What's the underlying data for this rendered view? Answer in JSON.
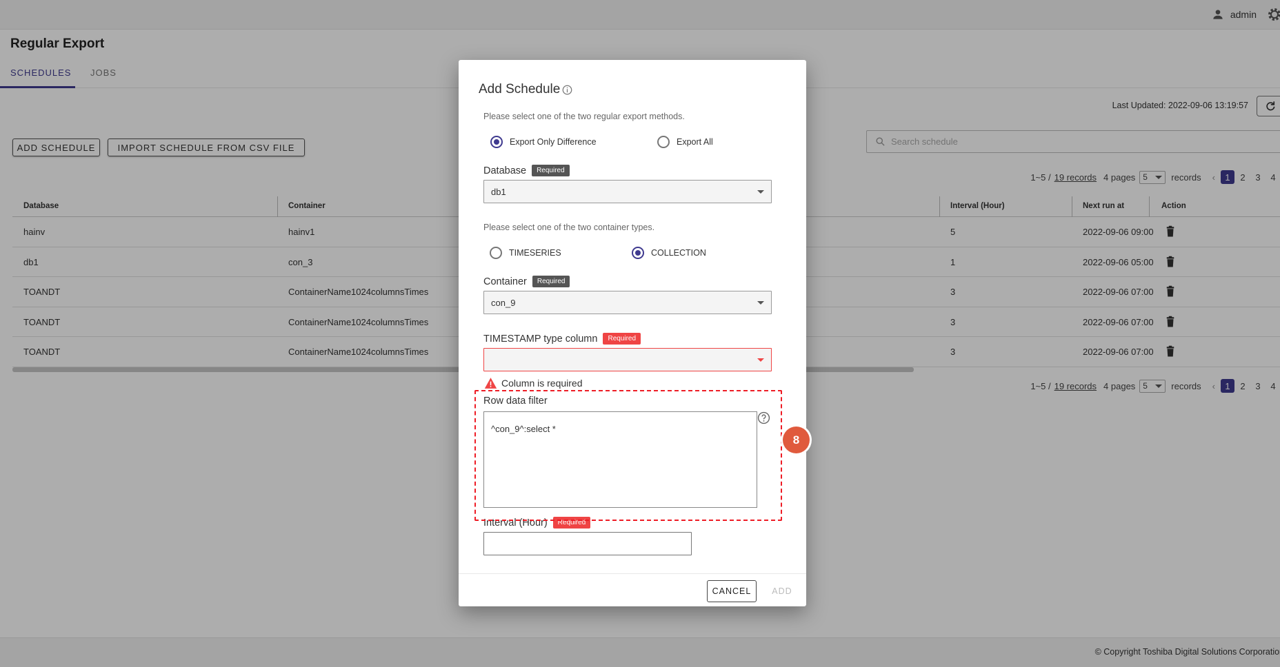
{
  "header": {
    "username": "admin"
  },
  "page": {
    "title": "Regular Export",
    "tabs": [
      {
        "label": "SCHEDULES",
        "active": true
      },
      {
        "label": "JOBS",
        "active": false
      }
    ],
    "last_updated": "Last Updated: 2022-09-06 13:19:57",
    "add_schedule_label": "ADD SCHEDULE",
    "import_label": "IMPORT SCHEDULE FROM CSV FILE",
    "search_placeholder": "Search schedule"
  },
  "pagination": {
    "range": "1~5 /",
    "records_link": "19 records",
    "pages": "4 pages",
    "page_size": "5",
    "records_suffix": "records",
    "page_numbers": [
      "1",
      "2",
      "3",
      "4"
    ],
    "current_page": "1"
  },
  "table": {
    "columns": [
      "Database",
      "Container",
      "Interval (Hour)",
      "Next run at",
      "Action"
    ],
    "rows": [
      {
        "database": "hainv",
        "container": "hainv1",
        "interval": "5",
        "next_run": "2022-09-06 09:00"
      },
      {
        "database": "db1",
        "container": "con_3",
        "interval": "1",
        "next_run": "2022-09-06 05:00"
      },
      {
        "database": "TOANDT",
        "container": "ContainerName1024columnsTimes",
        "interval": "3",
        "next_run": "2022-09-06 07:00"
      },
      {
        "database": "TOANDT",
        "container": "ContainerName1024columnsTimes",
        "interval": "3",
        "next_run": "2022-09-06 07:00"
      },
      {
        "database": "TOANDT",
        "container": "ContainerName1024columnsTimes",
        "interval": "3",
        "next_run": "2022-09-06 07:00"
      }
    ]
  },
  "footer": {
    "copyright": "© Copyright Toshiba Digital Solutions Corporation"
  },
  "modal": {
    "title": "Add Schedule",
    "export_hint": "Please select one of the two regular export methods.",
    "export_options": [
      {
        "label": "Export Only Difference",
        "checked": true
      },
      {
        "label": "Export All",
        "checked": false
      }
    ],
    "database_label": "Database",
    "required_badge": "Required",
    "database_value": "db1",
    "container_hint": "Please select one of the two container types.",
    "container_types": [
      {
        "label": "TIMESERIES",
        "checked": false
      },
      {
        "label": "COLLECTION",
        "checked": true
      }
    ],
    "container_label": "Container",
    "container_value": "con_9",
    "timestamp_label": "TIMESTAMP type column",
    "timestamp_value": "",
    "error_message": "Column is required",
    "row_filter_label": "Row data filter",
    "row_filter_value": "^con_9^:select *",
    "interval_label": "Interval (Hour)",
    "interval_value": "",
    "cancel_label": "CANCEL",
    "add_label": "ADD",
    "step_badge": "8"
  },
  "colors": {
    "accent": "#3f3a8f",
    "error": "#ef4444",
    "annotation": "#ee1c25",
    "step_badge": "#e05a3d"
  },
  "icons": {
    "user": "user-icon",
    "settings": "gear-icon",
    "refresh": "refresh-icon",
    "search": "search-icon",
    "delete": "trash-icon",
    "info": "info-icon",
    "warning": "warning-icon",
    "help": "help-icon",
    "dropdown": "caret-down-icon"
  }
}
